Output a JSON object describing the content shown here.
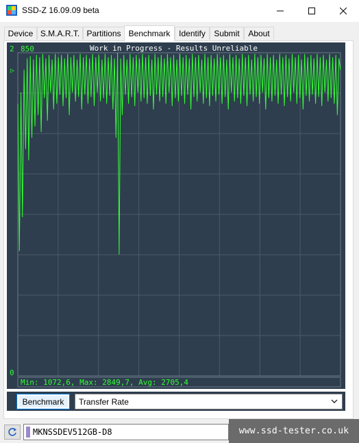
{
  "window": {
    "title": "SSD-Z 16.09.09 beta"
  },
  "tabs": [
    {
      "label": "Device",
      "active": false
    },
    {
      "label": "S.M.A.R.T.",
      "active": false
    },
    {
      "label": "Partitions",
      "active": false
    },
    {
      "label": "Benchmark",
      "active": true
    },
    {
      "label": "Identify",
      "active": false
    },
    {
      "label": "Submit",
      "active": false
    },
    {
      "label": "About",
      "active": false
    }
  ],
  "colors": {
    "chart_bg": "#2e3e4e",
    "chart_line": "#33ff33",
    "grid": "#4a5a68",
    "accent_border": "#0078d7"
  },
  "chart_data": {
    "type": "line",
    "title": "Work in Progress - Results Unreliable",
    "y_max_label_prefix": "2",
    "y_max_label": "850",
    "y_min_label": "0",
    "ylim": [
      0,
      2850
    ],
    "summary": "Min: 1072,6, Max: 2849,7, Avg: 2705,4",
    "grid": true,
    "series": [
      {
        "values": [
          2400,
          1100,
          2500,
          1400,
          2700,
          2000,
          2800,
          1900,
          2820,
          2100,
          2790,
          2200,
          2830,
          2300,
          2810,
          2150,
          2840,
          2450,
          2800,
          2250,
          2830,
          2500,
          2790,
          2350,
          2840,
          2400,
          2810,
          2480,
          2830,
          2380,
          2800,
          2450,
          2840,
          2300,
          2810,
          2500,
          2830,
          2420,
          2790,
          2460,
          2840,
          2350,
          2810,
          2480,
          2830,
          2400,
          2800,
          2460,
          2840,
          2380,
          2810,
          2500,
          2830,
          2420,
          2790,
          2450,
          2840,
          2400,
          2810,
          2470,
          2830,
          2350,
          2800,
          2100,
          2849,
          1072,
          2800,
          2300,
          2830,
          2480,
          2790,
          2400,
          2840,
          2460,
          2810,
          2380,
          2830,
          2500,
          2800,
          2420,
          2840,
          2450,
          2810,
          2400,
          2830,
          2470,
          2790,
          2350,
          2840,
          2480,
          2810,
          2420,
          2830,
          2460,
          2800,
          2400,
          2840,
          2500,
          2810,
          2380,
          2830,
          2450,
          2790,
          2420,
          2840,
          2470,
          2810,
          2400,
          2830,
          2480,
          2800,
          2350,
          2840,
          2460,
          2810,
          2420,
          2830,
          2500,
          2790,
          2400,
          2840,
          2450,
          2810,
          2380,
          2830,
          2470,
          2800,
          2420,
          2840,
          2480,
          2810,
          2400,
          2830,
          2460,
          2790,
          2350,
          2840,
          2500,
          2810,
          2420,
          2830,
          2450,
          2800,
          2400,
          2840,
          2470,
          2810,
          2380,
          2830,
          2480,
          2790,
          2420,
          2840,
          2460,
          2810,
          2400,
          2830,
          2500,
          2800,
          2350,
          2840,
          2450,
          2810,
          2420,
          2830,
          2470,
          2790,
          2400,
          2840,
          2480,
          2810,
          2380,
          2830,
          2460,
          2800,
          2420,
          2840,
          2500,
          2810,
          2400,
          2830,
          2450,
          2790,
          2350,
          2840,
          2470,
          2810,
          2420,
          2830,
          2480,
          2800,
          2400,
          2840,
          2460,
          2810,
          2380,
          2830,
          2500,
          2790,
          2420,
          2840,
          2450,
          2810,
          2400,
          2830,
          2300,
          2800,
          2700
        ]
      }
    ]
  },
  "controls": {
    "benchmark_button": "Benchmark",
    "mode_select": "Transfer Rate"
  },
  "status": {
    "drive": "MKNSSDEV512GB-D8",
    "watermark": "www.ssd-tester.co.uk"
  },
  "icons": {
    "app": "ssd-z-app-icon",
    "refresh": "refresh-icon",
    "dropdown": "chevron-down-icon"
  }
}
